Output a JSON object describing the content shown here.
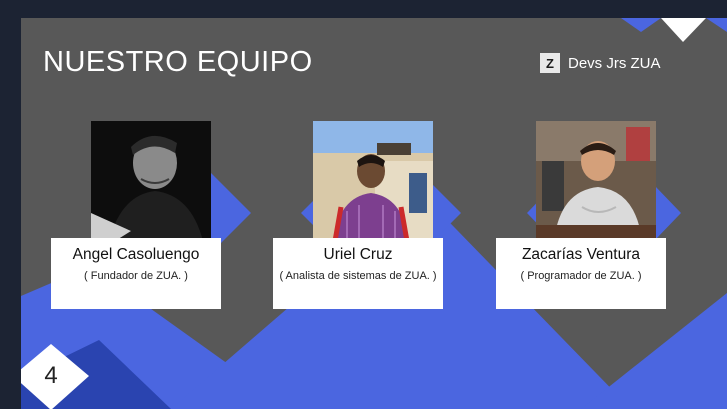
{
  "slide": {
    "title": "NUESTRO EQUIPO",
    "brand": {
      "logo_letter": "Z",
      "name": "Devs Jrs ZUA"
    },
    "page_number": "4"
  },
  "team": [
    {
      "name": "Angel Casoluengo",
      "role": "( Fundador de ZUA. )"
    },
    {
      "name": "Uriel Cruz",
      "role": "( Analista de sistemas de ZUA. )"
    },
    {
      "name": "Zacarías Ventura",
      "role": "( Programador de ZUA. )"
    }
  ],
  "colors": {
    "slide_bg": "#585858",
    "accent_blue": "#4b66e0",
    "dark_blue": "#2a44b0",
    "frame_bg": "#1c2333",
    "card_bg": "#ffffff"
  }
}
